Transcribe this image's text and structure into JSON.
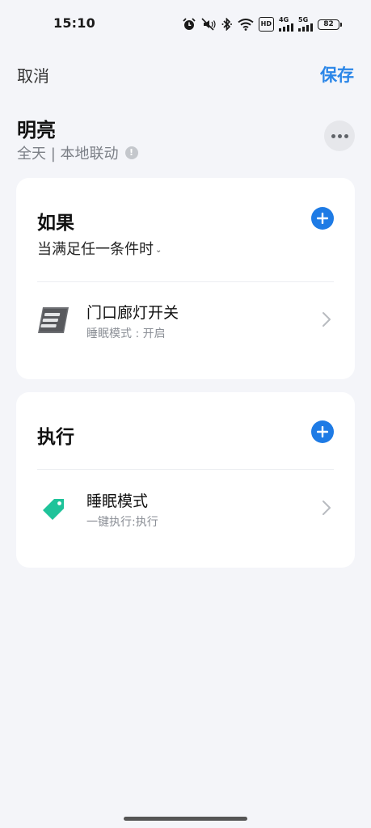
{
  "status_bar": {
    "time": "15:10",
    "network_4g": "4G",
    "network_5g": "5G",
    "hd_label": "HD",
    "battery": "82"
  },
  "header": {
    "cancel_label": "取消",
    "save_label": "保存",
    "accent_color": "#2a86e8"
  },
  "scene": {
    "title": "明亮",
    "subtitle": "全天 | 本地联动"
  },
  "if_card": {
    "heading": "如果",
    "condition_mode": "当满足任一条件时",
    "items": [
      {
        "title": "门口廊灯开关",
        "subtitle": "睡眠模式 : 开启",
        "icon": "wall-switch-icon"
      }
    ]
  },
  "do_card": {
    "heading": "执行",
    "items": [
      {
        "title": "睡眠模式",
        "subtitle": "一键执行:执行",
        "icon": "tag-icon"
      }
    ]
  }
}
